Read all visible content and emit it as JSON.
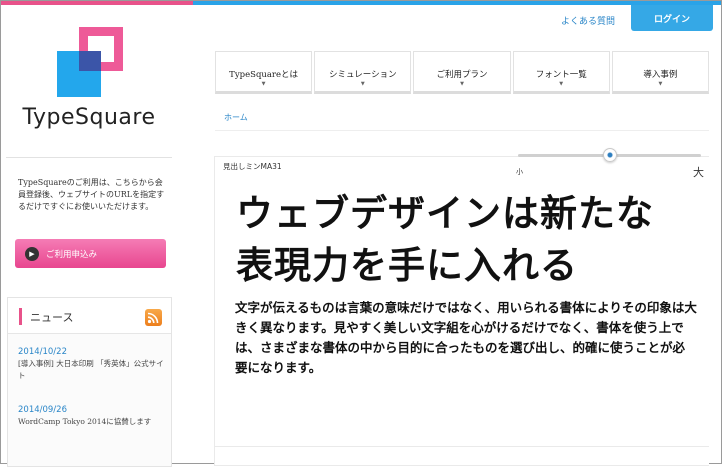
{
  "header": {
    "faq_label": "よくある質問",
    "login_label": "ログイン"
  },
  "colors": {
    "accent_pink": "#e8528a",
    "accent_blue": "#2aa3e8"
  },
  "logo": {
    "text": "TypeSquare"
  },
  "sidebar": {
    "intro": "TypeSquareのご利用は、こちらから会員登録後、ウェブサイトのURLを指定するだけですぐにお使いいただけます。",
    "apply_button": "ご利用申込み",
    "news": {
      "title": "ニュース",
      "items": [
        {
          "date": "2014/10/22",
          "text": "[導入事例] 大日本印刷 「秀英体」公式サイト"
        },
        {
          "date": "2014/09/26",
          "text": "WordCamp Tokyo 2014に協賛します"
        }
      ]
    }
  },
  "nav": {
    "items": [
      "TypeSquareとは",
      "シミュレーション",
      "ご利用プラン",
      "フォント一覧",
      "導入事例"
    ]
  },
  "breadcrumb": {
    "home": "ホーム"
  },
  "demo": {
    "font_name": "見出しミンMA31",
    "size_small": "小",
    "size_large": "大",
    "headline_line1": "ウェブデザインは新たな",
    "headline_line2": "表現力を手に入れる",
    "body": "文字が伝えるものは言葉の意味だけではなく、用いられる書体によりその印象は大きく異なります。見やすく美しい文字組を心がけるだけでなく、書体を使う上では、さまざまな書体の中から目的に合ったものを選び出し、的確に使うことが必要になります。"
  }
}
